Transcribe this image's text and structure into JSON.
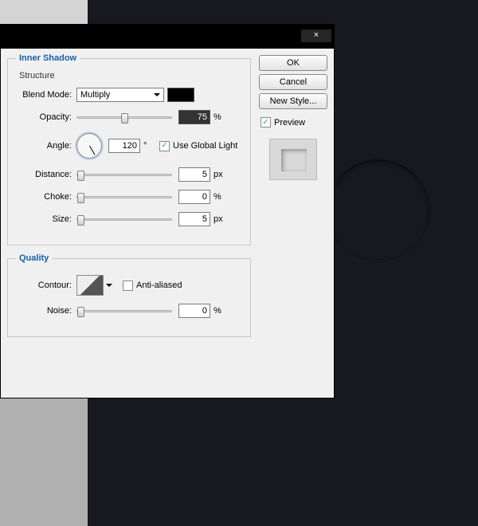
{
  "section_title": "Inner Shadow",
  "structure": {
    "legend": "Structure",
    "blend_mode_label": "Blend Mode:",
    "blend_mode_value": "Multiply",
    "color": "#000000",
    "opacity_label": "Opacity:",
    "opacity_value": "75",
    "opacity_unit": "%",
    "angle_label": "Angle:",
    "angle_value": "120",
    "angle_unit": "°",
    "use_global_light_label": "Use Global Light",
    "use_global_light_checked": true,
    "distance_label": "Distance:",
    "distance_value": "5",
    "distance_unit": "px",
    "choke_label": "Choke:",
    "choke_value": "0",
    "choke_unit": "%",
    "size_label": "Size:",
    "size_value": "5",
    "size_unit": "px"
  },
  "quality": {
    "legend": "Quality",
    "contour_label": "Contour:",
    "antialiased_label": "Anti-aliased",
    "antialiased_checked": false,
    "noise_label": "Noise:",
    "noise_value": "0",
    "noise_unit": "%"
  },
  "side": {
    "ok": "OK",
    "cancel": "Cancel",
    "new_style": "New Style...",
    "preview_label": "Preview",
    "preview_checked": true
  },
  "close_glyph": "×"
}
